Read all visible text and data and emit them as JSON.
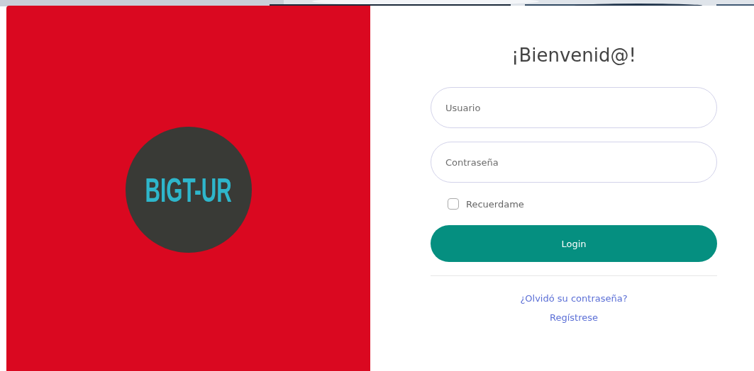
{
  "logo": {
    "text": "BIGT-UR"
  },
  "title": "¡Bienvenid@!",
  "fields": [
    {
      "placeholder": "Usuario"
    },
    {
      "placeholder": "Contraseña"
    }
  ],
  "remember": {
    "label": "Recuerdame",
    "checked": false
  },
  "login_button": "Login",
  "links": [
    "¿Olvidó su contraseña?",
    "Regístrese"
  ]
}
